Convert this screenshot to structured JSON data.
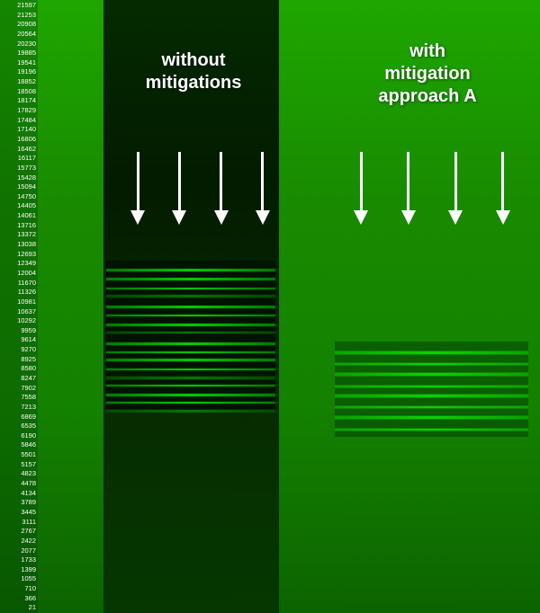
{
  "labels": {
    "without": "without\nmitigations",
    "with": "with\nmitigation\napproach A"
  },
  "yaxis": {
    "values": [
      "21597",
      "21253",
      "20908",
      "20564",
      "20230",
      "19885",
      "19541",
      "19196",
      "18852",
      "18508",
      "18174",
      "17829",
      "17484",
      "17140",
      "16806",
      "16462",
      "16117",
      "15773",
      "15428",
      "15094",
      "14750",
      "14405",
      "14061",
      "13716",
      "13372",
      "13038",
      "12693",
      "12349",
      "12004",
      "11670",
      "11326",
      "10981",
      "10637",
      "10292",
      "9959",
      "9614",
      "9270",
      "8925",
      "8580",
      "8247",
      "7902",
      "7558",
      "7213",
      "6869",
      "6535",
      "6190",
      "5846",
      "5501",
      "5157",
      "4823",
      "4478",
      "4134",
      "3789",
      "3445",
      "3111",
      "2767",
      "2422",
      "2077",
      "1733",
      "1399",
      "1055",
      "710",
      "366",
      "21"
    ]
  },
  "colors": {
    "background": "#1a8a00",
    "text_white": "#ffffff",
    "dark_column": "rgba(0,15,0,0.88)",
    "bright_green": "#00ff00"
  }
}
